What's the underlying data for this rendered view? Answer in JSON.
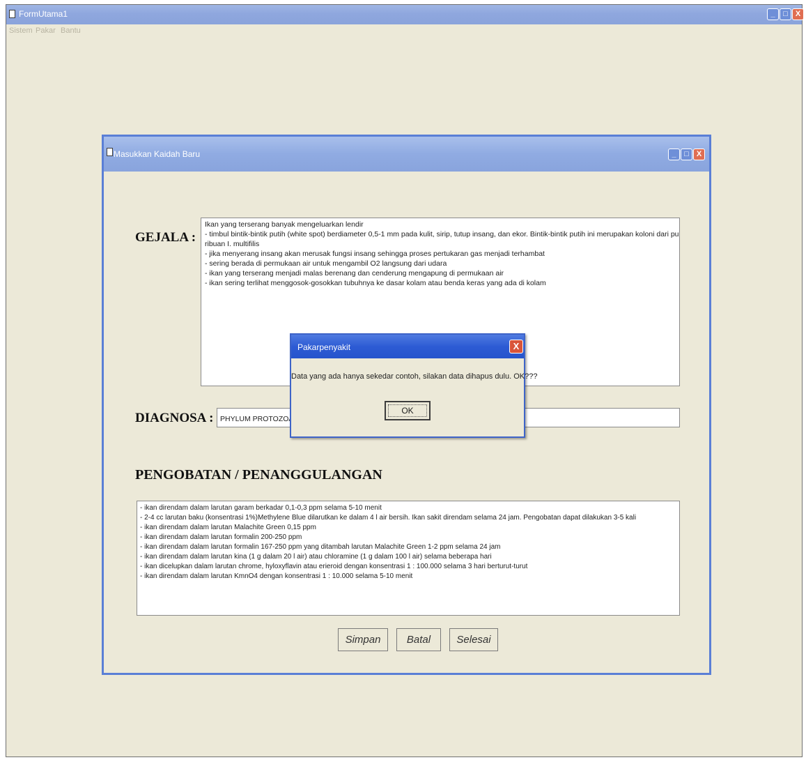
{
  "main_window": {
    "title": "FormUtama1",
    "menu": [
      "Sistem",
      "Pakar",
      "Bantu"
    ]
  },
  "child_window": {
    "title": "Masukkan Kaidah Baru"
  },
  "form": {
    "gejala_label": "GEJALA :",
    "gejala_lines": [
      "Ikan yang terserang banyak mengeluarkan lendir",
      "- timbul bintik-bintik putih (white spot) berdiameter 0,5-1 mm pada kulit, sirip, tutup insang, dan ekor. Bintik-bintik putih ini merupakan koloni dari puluhan hingga",
      "ribuan I. multifilis",
      "- jika menyerang insang akan merusak fungsi insang sehingga proses pertukaran gas menjadi terhambat",
      "- sering berada di permukaan air untuk mengambil O2 langsung dari udara",
      "- ikan yang terserang menjadi malas berenang dan cenderung mengapung di permukaan air",
      "- ikan sering terlihat menggosok-gosokkan tubuhnya ke dasar kolam atau benda keras yang ada di kolam"
    ],
    "diagnosa_label": "DIAGNOSA :",
    "diagnosa_value": "PHYLUM PROTOZOA :",
    "pengobatan_label": "PENGOBATAN / PENANGGULANGAN",
    "pengobatan_lines": [
      "- ikan direndam dalam larutan garam berkadar 0,1-0,3 ppm selama 5-10 menit",
      "- 2-4 cc larutan baku (konsentrasi 1%)Methylene Blue dilarutkan ke dalam 4 l air bersih. Ikan sakit direndam selama 24 jam. Pengobatan dapat dilakukan 3-5 kali",
      "- ikan direndam dalam larutan Malachite Green 0,15 ppm",
      "- ikan direndam dalam larutan formalin 200-250 ppm",
      "- ikan direndam dalam larutan formalin 167-250 ppm yang ditambah larutan Malachite Green 1-2 ppm selama 24 jam",
      "- ikan direndam dalam larutan kina (1 g dalam 20 l air) atau chloramine (1 g dalam 100 l air) selama beberapa hari",
      "- ikan dicelupkan dalam larutan chrome, hyloxyflavin atau erieroid dengan konsentrasi 1 : 100.000 selama 3 hari berturut-turut",
      "- ikan direndam dalam larutan KmnO4 dengan konsentrasi 1 : 10.000 selama 5-10 menit"
    ],
    "buttons": {
      "simpan": "Simpan",
      "batal": "Batal",
      "selesai": "Selesai"
    }
  },
  "message_box": {
    "title": "Pakarpenyakit",
    "text": "Data yang ada hanya sekedar contoh, silakan data dihapus dulu. OK???",
    "ok_label": "OK",
    "close_glyph": "X"
  },
  "titlebar_glyphs": {
    "minimize": "_",
    "maximize": "□",
    "close": "X"
  }
}
